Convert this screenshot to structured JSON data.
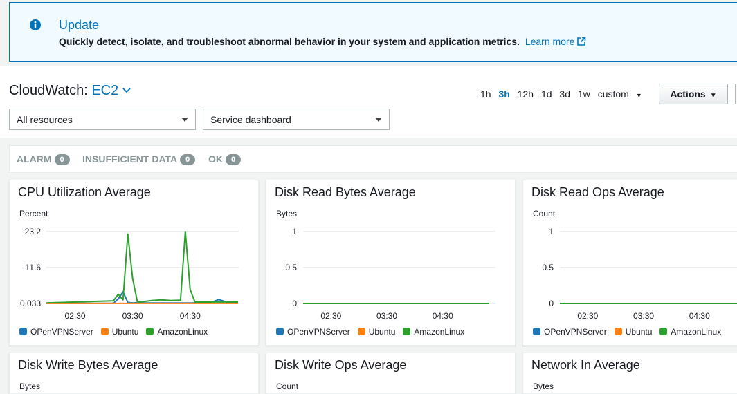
{
  "banner": {
    "title": "Update",
    "message": "Quickly detect, isolate, and troubleshoot abnormal behavior in your system and application metrics.",
    "link": "Learn more"
  },
  "header": {
    "prefix": "CloudWatch:",
    "service": "EC2",
    "time_ranges": [
      "1h",
      "3h",
      "12h",
      "1d",
      "3d",
      "1w",
      "custom"
    ],
    "active_range": "3h",
    "actions_label": "Actions",
    "resources_select": "All resources",
    "dashboard_select": "Service dashboard"
  },
  "status": [
    {
      "label": "ALARM",
      "count": "0"
    },
    {
      "label": "INSUFFICIENT DATA",
      "count": "0"
    },
    {
      "label": "OK",
      "count": "0"
    }
  ],
  "colors": {
    "OPenVPNServer": "#1f77b4",
    "Ubuntu": "#ff7f0e",
    "AmazonLinux": "#2ca02c",
    "link": "#0073bb"
  },
  "chart_data": [
    {
      "type": "line",
      "title": "CPU Utilization Average",
      "ylabel": "Percent",
      "y_ticks": [
        "23.2",
        "11.6",
        "0.033"
      ],
      "ylim": [
        0.033,
        23.2
      ],
      "x_ticks": [
        "02:30",
        "03:30",
        "04:30"
      ],
      "x": [
        "02:00",
        "02:10",
        "02:20",
        "02:30",
        "02:40",
        "02:50",
        "03:00",
        "03:10",
        "03:15",
        "03:20",
        "03:25",
        "03:30",
        "03:35",
        "03:40",
        "03:50",
        "04:00",
        "04:10",
        "04:20",
        "04:25",
        "04:30",
        "04:35",
        "04:40",
        "04:50",
        "05:00",
        "05:10",
        "05:20"
      ],
      "series": [
        {
          "name": "OPenVPNServer",
          "values": [
            0.1,
            0.1,
            0.1,
            0.1,
            0.1,
            0.1,
            0.1,
            0.1,
            1.5,
            3.8,
            0.4,
            0.2,
            0.3,
            0.2,
            0.2,
            0.2,
            0.2,
            0.2,
            0.2,
            0.2,
            0.2,
            0.2,
            0.2,
            1.3,
            0.3,
            0.2
          ]
        },
        {
          "name": "Ubuntu",
          "values": [
            0.05,
            0.05,
            0.05,
            0.05,
            0.05,
            0.05,
            0.05,
            0.05,
            0.05,
            0.05,
            0.05,
            0.05,
            0.05,
            0.05,
            0.05,
            0.05,
            0.05,
            0.05,
            0.05,
            0.05,
            0.05,
            0.05,
            0.05,
            0.05,
            0.05,
            0.05
          ]
        },
        {
          "name": "AmazonLinux",
          "values": [
            0.2,
            0.3,
            0.4,
            0.5,
            0.6,
            0.7,
            0.8,
            0.9,
            3.0,
            1.2,
            22.4,
            8.0,
            0.5,
            0.6,
            1.0,
            1.2,
            1.0,
            1.1,
            23.2,
            4.5,
            0.5,
            0.5,
            0.5,
            0.5,
            0.5,
            0.5
          ]
        }
      ]
    },
    {
      "type": "line",
      "title": "Disk Read Bytes Average",
      "ylabel": "Bytes",
      "y_ticks": [
        "1",
        "0.5",
        "0"
      ],
      "ylim": [
        0,
        1
      ],
      "x_ticks": [
        "02:30",
        "03:30",
        "04:30"
      ],
      "x": [
        "02:00",
        "05:20"
      ],
      "series": [
        {
          "name": "OPenVPNServer",
          "values": [
            0,
            0
          ]
        },
        {
          "name": "Ubuntu",
          "values": [
            0,
            0
          ]
        },
        {
          "name": "AmazonLinux",
          "values": [
            0,
            0
          ]
        }
      ]
    },
    {
      "type": "line",
      "title": "Disk Read Ops Average",
      "ylabel": "Count",
      "y_ticks": [
        "1",
        "0.5",
        "0"
      ],
      "ylim": [
        0,
        1
      ],
      "x_ticks": [
        "02:30",
        "03:30",
        "04:30"
      ],
      "x": [
        "02:00",
        "05:20"
      ],
      "series": [
        {
          "name": "OPenVPNServer",
          "values": [
            0,
            0
          ]
        },
        {
          "name": "Ubuntu",
          "values": [
            0,
            0
          ]
        },
        {
          "name": "AmazonLinux",
          "values": [
            0,
            0
          ]
        }
      ]
    },
    {
      "type": "line",
      "title": "Disk Write Bytes Average",
      "ylabel": "Bytes"
    },
    {
      "type": "line",
      "title": "Disk Write Ops Average",
      "ylabel": "Count"
    },
    {
      "type": "line",
      "title": "Network In Average",
      "ylabel": "Bytes"
    }
  ]
}
